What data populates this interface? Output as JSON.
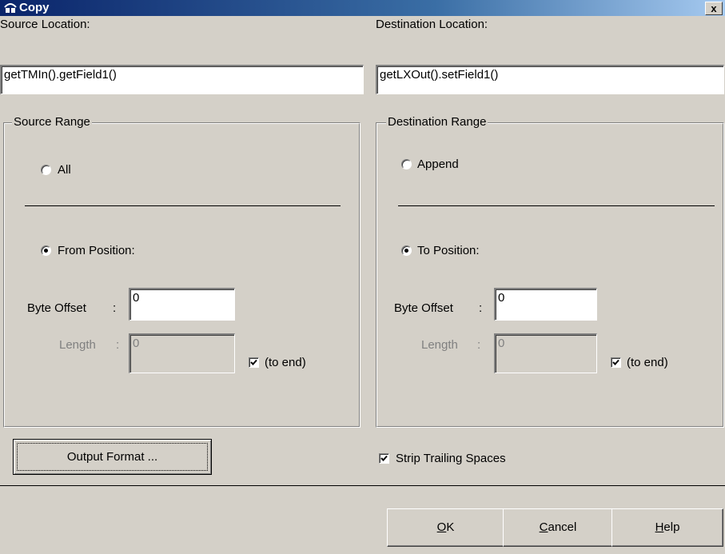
{
  "window": {
    "title": "Copy",
    "close_glyph": "x"
  },
  "source": {
    "location_label": "Source Location:",
    "location_value": "getTMIn().getField1()",
    "range_legend": "Source Range",
    "all_label": "All",
    "from_position_label": "From Position:",
    "byte_offset_label": "Byte Offset",
    "byte_offset_value": "0",
    "length_label": "Length",
    "length_value": "0",
    "to_end_label": "(to end)",
    "colon": ":"
  },
  "destination": {
    "location_label": "Destination Location:",
    "location_value": "getLXOut().setField1()",
    "range_legend": "Destination Range",
    "append_label": "Append",
    "to_position_label": "To Position:",
    "byte_offset_label": "Byte Offset",
    "byte_offset_value": "0",
    "length_label": "Length",
    "length_value": "0",
    "to_end_label": "(to end)",
    "colon": ":"
  },
  "options": {
    "output_format_label": "Output Format ...",
    "strip_trailing_label": "Strip Trailing Spaces"
  },
  "footer": {
    "ok_hotkey": "O",
    "ok_rest": "K",
    "cancel_hotkey": "C",
    "cancel_rest": "ancel",
    "help_hotkey": "H",
    "help_rest": "elp"
  },
  "state": {
    "source_all_selected": false,
    "source_from_selected": true,
    "source_to_end_checked": true,
    "dest_append_selected": false,
    "dest_to_selected": true,
    "dest_to_end_checked": true,
    "strip_trailing_checked": true
  },
  "icons": {
    "title": "copy-app-icon",
    "check": "checkmark-icon"
  },
  "colors": {
    "titlebar_start": "#0a246a",
    "titlebar_end": "#a6caf0",
    "dialog_face": "#d4d0c8"
  }
}
